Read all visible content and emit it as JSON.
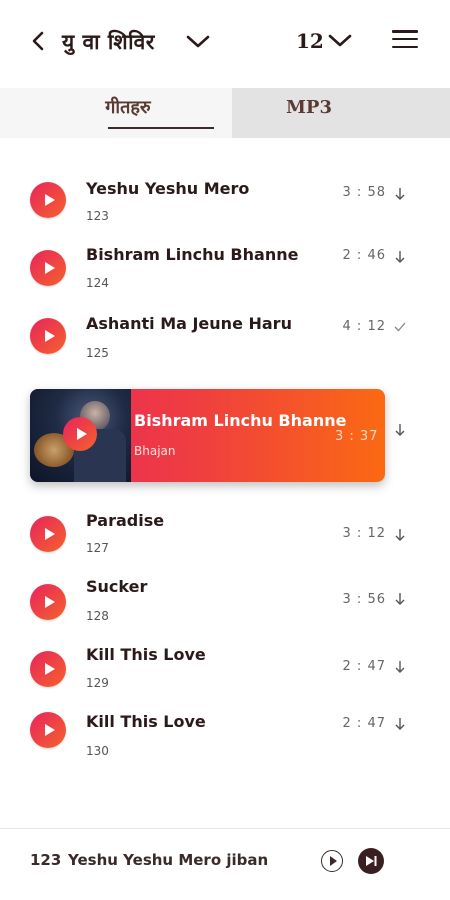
{
  "header": {
    "title": "यु वा शिविर",
    "number": "12"
  },
  "tabs": [
    {
      "label": "गीतहरु",
      "active": true
    },
    {
      "label": "MP3",
      "active": false
    }
  ],
  "songs": [
    {
      "title": "Yeshu Yeshu Mero",
      "number": "123",
      "duration": "3 : 58",
      "status_icon": "download-icon"
    },
    {
      "title": "Bishram Linchu Bhanne",
      "number": "124",
      "duration": "2 : 46",
      "status_icon": "download-icon"
    },
    {
      "title": "Ashanti Ma Jeune Haru",
      "number": "125",
      "duration": "4 : 12",
      "status_icon": "check-icon"
    },
    {
      "title": "Paradise",
      "number": "127",
      "duration": "3 : 12",
      "status_icon": "download-icon"
    },
    {
      "title": "Sucker",
      "number": "128",
      "duration": "3 : 56",
      "status_icon": "download-icon"
    },
    {
      "title": "Kill This Love",
      "number": "129",
      "duration": "2 : 47",
      "status_icon": "download-icon"
    },
    {
      "title": "Kill This Love",
      "number": "130",
      "duration": "2 : 47",
      "status_icon": "download-icon"
    }
  ],
  "featured": {
    "title": "Bishram Linchu Bhanne",
    "subtitle": "Bhajan",
    "duration": "3 : 37"
  },
  "now_playing": {
    "number": "123",
    "title": "Yeshu Yeshu Mero jiban"
  },
  "colors": {
    "accent_start": "#e8245c",
    "accent_end": "#fa6a12",
    "text_dark": "#2b1a1a"
  }
}
